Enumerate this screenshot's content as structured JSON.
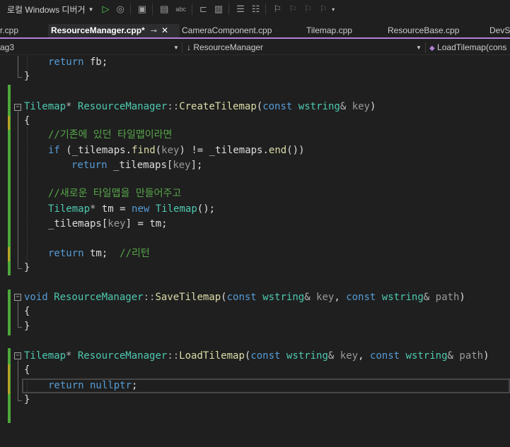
{
  "toolbar": {
    "debugger_label": "로컬 Windows 디버거",
    "icons": [
      "play-icon",
      "attach-icon",
      "folder-icon",
      "layout-icon",
      "spellcheck-icon",
      "step-icon",
      "format-icon",
      "comment-icon",
      "uncomment-icon",
      "bookmark-icon",
      "bookmark-prev-icon",
      "bookmark-next-icon",
      "bookmark-clear-icon",
      "overflow-icon"
    ],
    "colors": {
      "play": "#4ec94e"
    }
  },
  "tabs": [
    {
      "label": "r.cpp"
    },
    {
      "label": "ResourceManager.cpp*",
      "active": true,
      "pin": "⊸",
      "close": "✕"
    },
    {
      "label": "CameraComponent.cpp"
    },
    {
      "label": "Tilemap.cpp"
    },
    {
      "label": "ResourceBase.cpp"
    },
    {
      "label": "DevS"
    }
  ],
  "navbar": {
    "project": "ag3",
    "scope": "↓ ResourceManager",
    "member": "LoadTilemap(cons"
  },
  "code": {
    "l1": {
      "kw": "return",
      "rest": " fb;"
    },
    "l2": "}",
    "l4": {
      "ret_type": "Tilemap",
      "star": "*",
      "cls": "ResourceManager",
      "sep": "::",
      "fn": "CreateTilemap",
      "open": "(",
      "const": "const",
      "type": "wstring",
      "amp": "&",
      "param": "key",
      "close": ")"
    },
    "l5": "{",
    "l6": "//기존에 있던 타일맵이라면",
    "l7": {
      "kw": "if",
      "a": " (",
      "member": "_tilemaps",
      "b": ".",
      "fn1": "find",
      "c": "(",
      "p": "key",
      "d": ") != ",
      "member2": "_tilemaps",
      "e": ".",
      "fn2": "end",
      "f": "())"
    },
    "l8": {
      "kw": "return",
      "sp": " ",
      "member": "_tilemaps",
      "a": "[",
      "p": "key",
      "b": "];"
    },
    "l10": "//새로운 타일맵을 만들어주고",
    "l11": {
      "ty": "Tilemap",
      "star": "*",
      "var": " tm",
      "eq": " = ",
      "kw": "new",
      "ty2": " Tilemap",
      "end": "();"
    },
    "l12": {
      "member": "_tilemaps",
      "a": "[",
      "p": "key",
      "b": "] = ",
      "var": "tm",
      "c": ";"
    },
    "l14": {
      "kw": "return",
      "var": " tm;",
      "cm": "  //리턴"
    },
    "l15": "}",
    "l17": {
      "kw": "void",
      "cls": " ResourceManager",
      "sep": "::",
      "fn": "SaveTilemap",
      "open": "(",
      "const1": "const",
      "type1": " wstring",
      "amp1": "&",
      "p1": " key",
      "comma": ", ",
      "const2": "const",
      "type2": " wstring",
      "amp2": "&",
      "p2": " path",
      "close": ")"
    },
    "l18": "{",
    "l19": "}",
    "l21": {
      "ret_type": "Tilemap",
      "star": "*",
      "cls": " ResourceManager",
      "sep": "::",
      "fn": "LoadTilemap",
      "open": "(",
      "const1": "const",
      "type1": " wstring",
      "amp1": "&",
      "p1": " key",
      "comma": ", ",
      "const2": "const",
      "type2": " wstring",
      "amp2": "&",
      "p2": " path",
      "close": ")"
    },
    "l22": "{",
    "l23": {
      "kw": "return",
      "val": " nullptr",
      "end": ";"
    },
    "l24": "}"
  }
}
